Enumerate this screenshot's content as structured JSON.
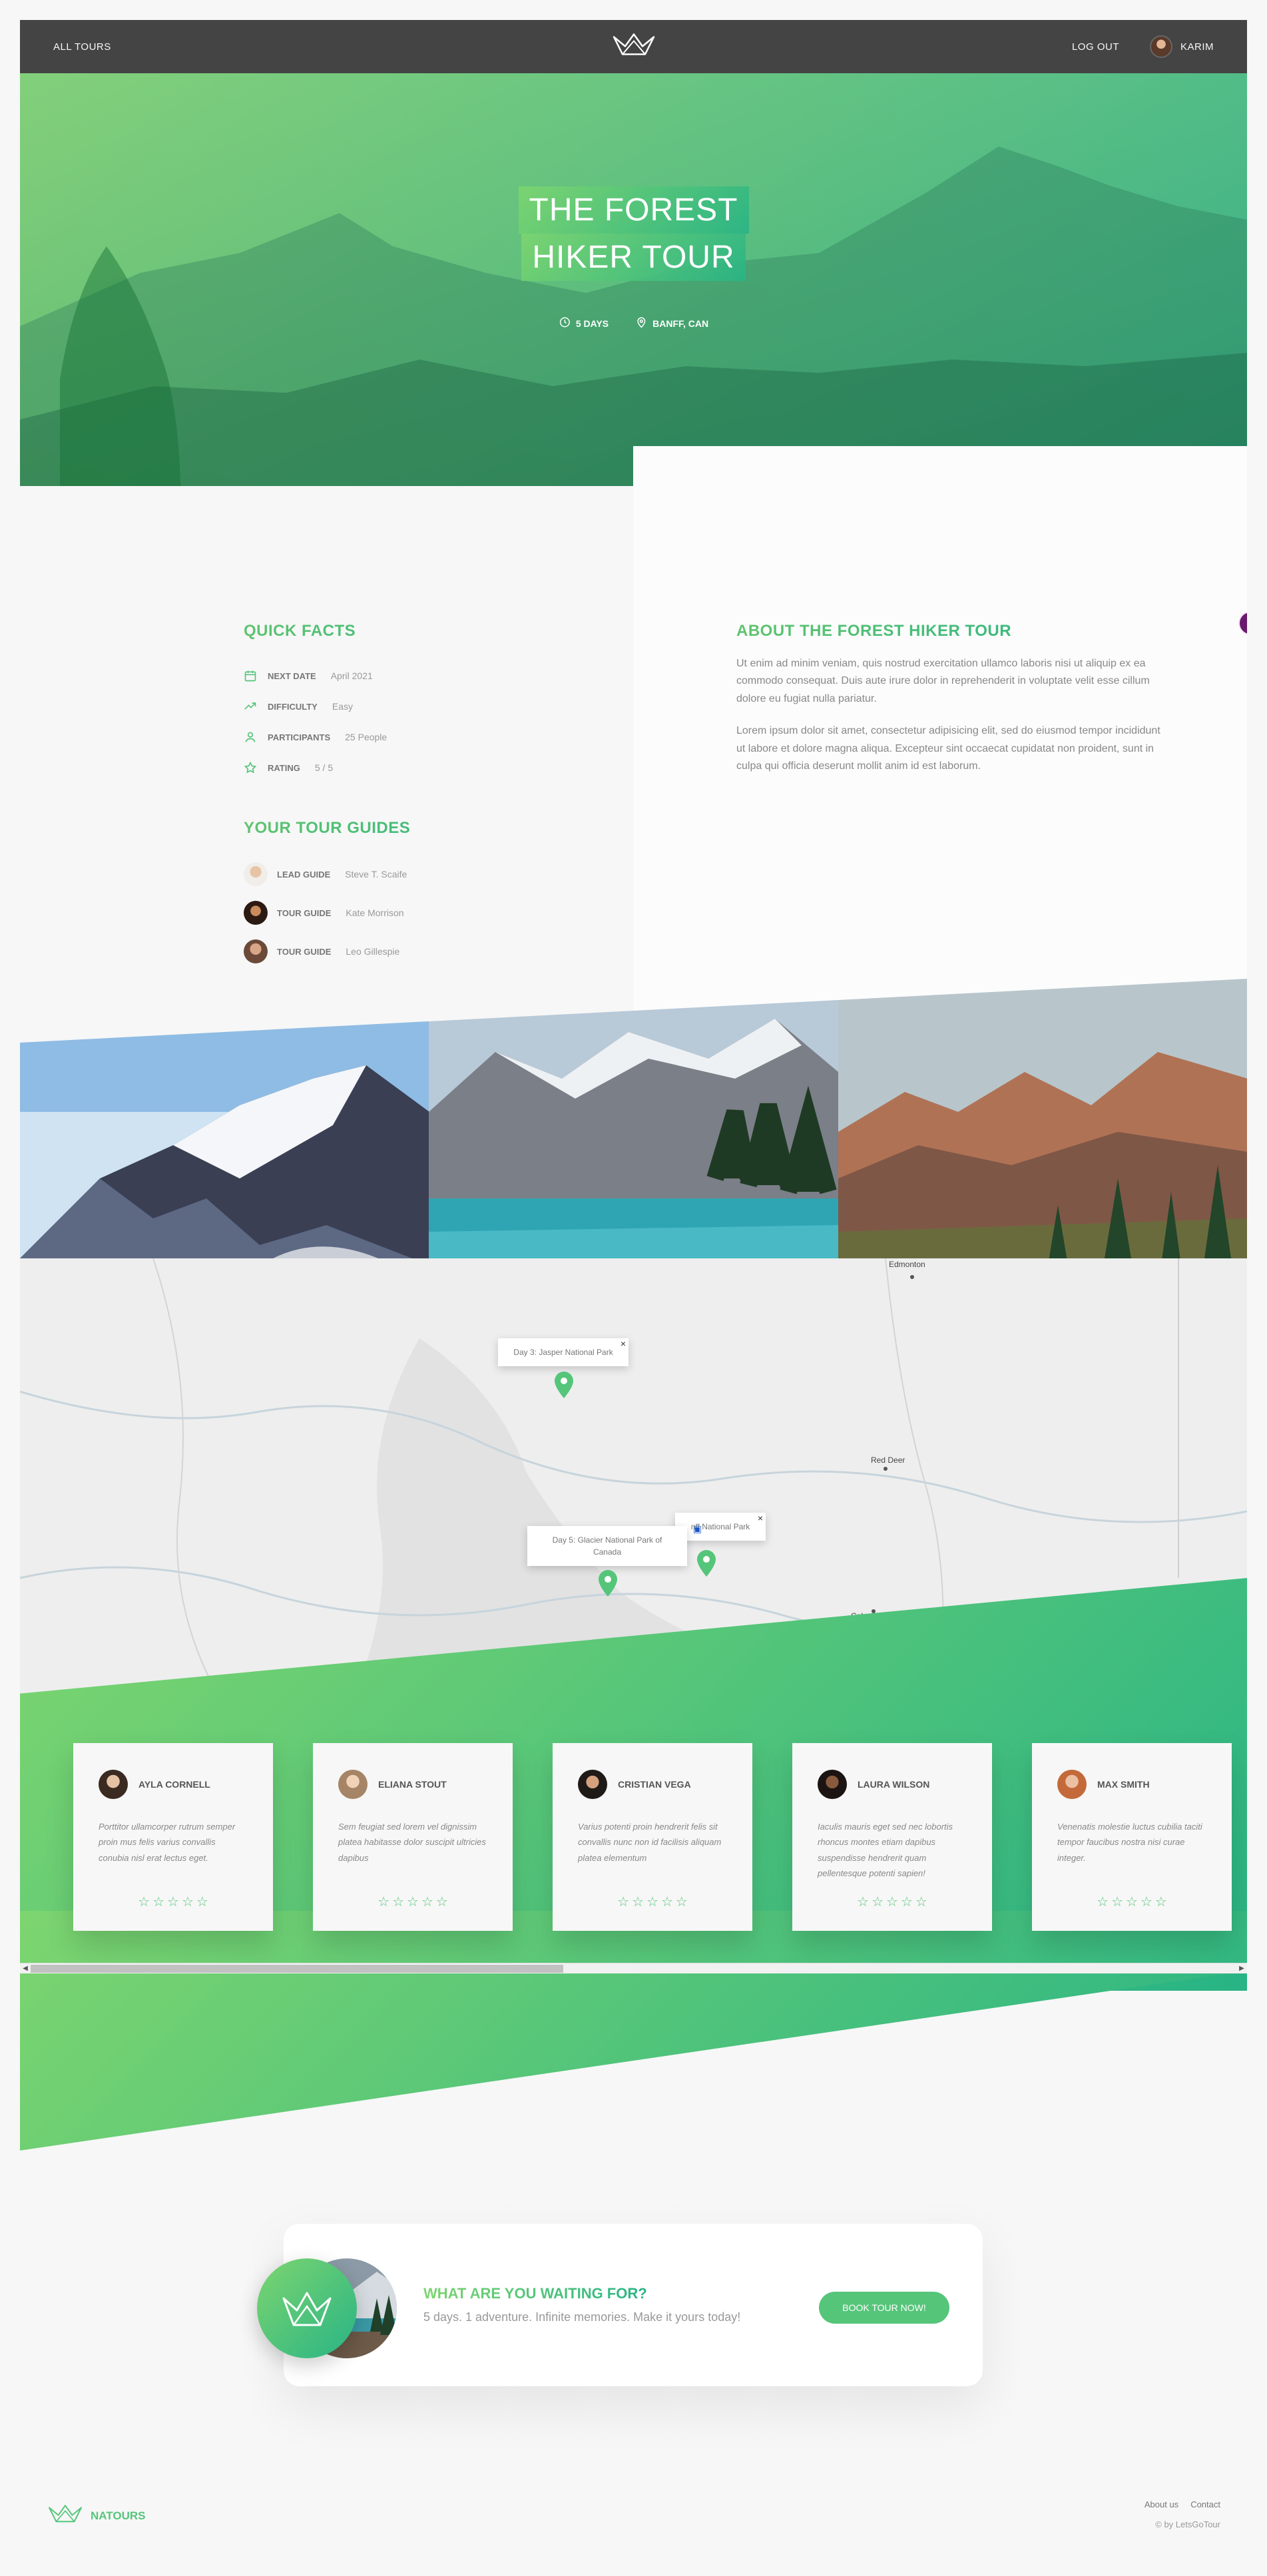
{
  "header": {
    "all_tours": "All tours",
    "logout": "Log out",
    "user_name": "Karim"
  },
  "hero": {
    "title_line1": "The Forest",
    "title_line2": "Hiker Tour",
    "duration": "5 days",
    "location": "Banff, CAN"
  },
  "quick_facts": {
    "heading": "Quick facts",
    "items": [
      {
        "label": "Next date",
        "value": "April 2021",
        "icon": "calendar-icon"
      },
      {
        "label": "Difficulty",
        "value": "Easy",
        "icon": "trending-up-icon"
      },
      {
        "label": "Participants",
        "value": "25 People",
        "icon": "user-icon"
      },
      {
        "label": "Rating",
        "value": "5 / 5",
        "icon": "star-icon"
      }
    ]
  },
  "guides": {
    "heading": "Your tour guides",
    "items": [
      {
        "role": "Lead guide",
        "name": "Steve T. Scaife"
      },
      {
        "role": "Tour guide",
        "name": "Kate Morrison"
      },
      {
        "role": "Tour guide",
        "name": "Leo Gillespie"
      }
    ]
  },
  "about": {
    "heading": "About the Forest Hiker tour",
    "p1": "Ut enim ad minim veniam, quis nostrud exercitation ullamco laboris nisi ut aliquip ex ea commodo consequat. Duis aute irure dolor in reprehenderit in voluptate velit esse cillum dolore eu fugiat nulla pariatur.",
    "p2": "Lorem ipsum dolor sit amet, consectetur adipisicing elit, sed do eiusmod tempor incididunt ut labore et dolore magna aliqua. Excepteur sint occaecat cupidatat non proident, sunt in culpa qui officia deserunt mollit anim id est laborum."
  },
  "map": {
    "labels": [
      "Edmonton",
      "Red Deer",
      "Calgary"
    ],
    "popups": [
      "Day 3: Jasper National Park",
      "Day 5: Glacier National Park of Canada",
      "Banff National Park"
    ],
    "popup_partial": "nff National Park"
  },
  "reviews": [
    {
      "name": "Ayla Cornell",
      "text": "Porttitor ullamcorper rutrum semper proin mus felis varius convallis conubia nisl erat lectus eget."
    },
    {
      "name": "Eliana Stout",
      "text": "Sem feugiat sed lorem vel dignissim platea habitasse dolor suscipit ultricies dapibus"
    },
    {
      "name": "Cristian Vega",
      "text": "Varius potenti proin hendrerit felis sit convallis nunc non id facilisis aliquam platea elementum"
    },
    {
      "name": "Laura Wilson",
      "text": "Iaculis mauris eget sed nec lobortis rhoncus montes etiam dapibus suspendisse hendrerit quam pellentesque potenti sapien!"
    },
    {
      "name": "Max Smith",
      "text": "Venenatis molestie luctus cubilia taciti tempor faucibus nostra nisi curae integer."
    }
  ],
  "cta": {
    "title": "What are you waiting for?",
    "subtitle": "5 days. 1 adventure. Infinite memories. Make it yours today!",
    "button": "Book tour now!"
  },
  "footer": {
    "brand": "NATOURS",
    "link_about": "About us",
    "link_contact": "Contact",
    "copyright": "© by LetsGoTour"
  },
  "notification_count": "0",
  "colors": {
    "primary": "#55c57a",
    "gradient_start": "#7dd56f",
    "gradient_end": "#28b485",
    "header_bg": "#444444"
  }
}
